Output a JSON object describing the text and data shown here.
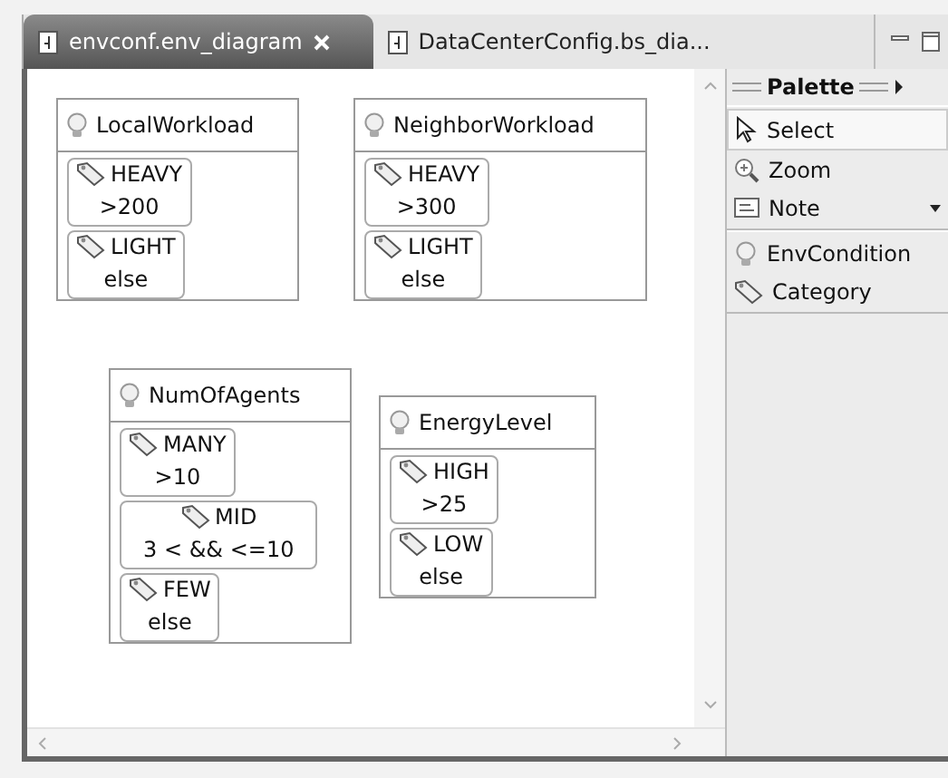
{
  "tabs": [
    {
      "label": "envconf.env_diagram",
      "selected": true,
      "closable": true
    },
    {
      "label": "DataCenterConfig.bs_dia...",
      "selected": false,
      "closable": false
    }
  ],
  "diagram": {
    "nodes": [
      {
        "name": "LocalWorkload",
        "categories": [
          {
            "name": "HEAVY",
            "condition": ">200"
          },
          {
            "name": "LIGHT",
            "condition": "else"
          }
        ]
      },
      {
        "name": "NeighborWorkload",
        "categories": [
          {
            "name": "HEAVY",
            "condition": ">300"
          },
          {
            "name": "LIGHT",
            "condition": "else"
          }
        ]
      },
      {
        "name": "NumOfAgents",
        "categories": [
          {
            "name": "MANY",
            "condition": ">10"
          },
          {
            "name": "MID",
            "condition": "3 < && <=10"
          },
          {
            "name": "FEW",
            "condition": "else"
          }
        ]
      },
      {
        "name": "EnergyLevel",
        "categories": [
          {
            "name": "HIGH",
            "condition": ">25"
          },
          {
            "name": "LOW",
            "condition": "else"
          }
        ]
      }
    ]
  },
  "palette": {
    "title": "Palette",
    "groups": [
      [
        {
          "label": "Select",
          "kind": "select",
          "selected": true
        },
        {
          "label": "Zoom",
          "kind": "zoom",
          "selected": false
        },
        {
          "label": "Note",
          "kind": "note",
          "selected": false
        }
      ],
      [
        {
          "label": "EnvCondition",
          "kind": "condition",
          "selected": false
        },
        {
          "label": "Category",
          "kind": "category",
          "selected": false
        }
      ]
    ]
  }
}
